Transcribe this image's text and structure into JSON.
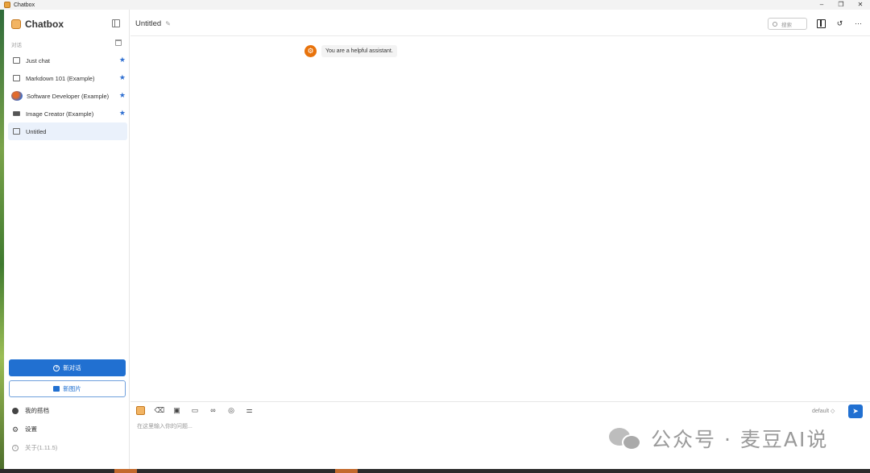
{
  "window": {
    "title": "Chatbox",
    "controls": [
      "–",
      "❐",
      "✕"
    ]
  },
  "sidebar": {
    "brand": "Chatbox",
    "section_label": "对话",
    "items": [
      {
        "label": "Just chat",
        "icon": "chat-bubble-icon",
        "starred": true
      },
      {
        "label": "Markdown 101 (Example)",
        "icon": "chat-bubble-icon",
        "starred": true
      },
      {
        "label": "Software Developer (Example)",
        "icon": "avatar-image-icon",
        "starred": true
      },
      {
        "label": "Image Creator (Example)",
        "icon": "picture-icon",
        "starred": true
      },
      {
        "label": "Untitled",
        "icon": "chat-bubble-icon",
        "starred": false
      }
    ],
    "new_chat_label": "新对话",
    "new_image_label": "新图片",
    "footer": [
      {
        "label": "我的搭档",
        "icon": "partner-icon"
      },
      {
        "label": "设置",
        "icon": "gear-icon"
      },
      {
        "label": "关于(1.11.5)",
        "icon": "info-icon"
      }
    ]
  },
  "main": {
    "title": "Untitled",
    "search_placeholder": "搜索",
    "system_message": "You are a helpful assistant.",
    "model": "default ◇",
    "input_placeholder": "在这里输入你的问题...",
    "toolbar_icons": [
      "chatbox-logo-icon",
      "eraser-icon",
      "image-icon",
      "folder-icon",
      "link-icon",
      "globe-icon",
      "settings-sliders-icon"
    ]
  },
  "watermark": "公众号 · 麦豆AI说",
  "colors": {
    "accent": "#2170d1",
    "star": "#2f6fd1",
    "system_avatar": "#e8730c"
  }
}
